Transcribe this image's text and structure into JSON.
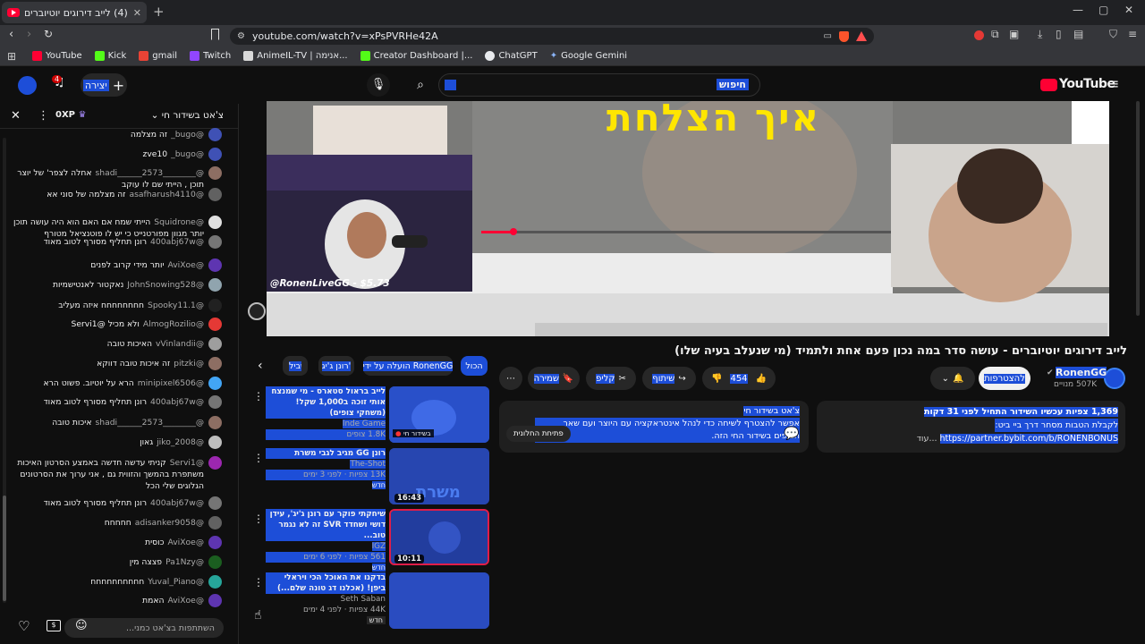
{
  "browser": {
    "tab_title": "(4) לייב דירוגים יוטיוברים - עושה",
    "url": "youtube.com/watch?v=xPsPVRHe42A",
    "bookmarks": [
      {
        "label": "YouTube",
        "color": "#ff0033"
      },
      {
        "label": "Kick",
        "color": "#53fc18"
      },
      {
        "label": "gmail",
        "color": "#ea4335"
      },
      {
        "label": "Twitch",
        "color": "#9146ff"
      },
      {
        "label": "AnimeIL-TV | אנימה...",
        "color": "#d9d9d9"
      },
      {
        "label": "Creator Dashboard |...",
        "color": "#53fc18"
      },
      {
        "label": "ChatGPT",
        "color": "#e8eaed"
      },
      {
        "label": "Google Gemini",
        "color": "#8ab4f8"
      }
    ]
  },
  "header": {
    "logo_text": "YouTube",
    "search_query": "חיפוש",
    "create_label": "יצירה",
    "notification_count": "4"
  },
  "chat": {
    "title": "צ'אט בשידור חי",
    "xp_label": "0XP",
    "input_placeholder": "השתתפות בצ'אט כמני...",
    "messages": [
      {
        "author": "@bugo_",
        "text": "זה מצלמה",
        "color": "#3f51b5"
      },
      {
        "author": "@bugo_",
        "text": "zve10",
        "color": "#3f51b5"
      },
      {
        "author": "@________shadi______2573",
        "text": "אחלה לצפר' של יוצר תוכן , הייתי שם לו עוקב",
        "color": "#8d6e63"
      },
      {
        "author": "@asafharush4110",
        "text": "זה מצלמה של סוני אא",
        "color": "#616161"
      },
      {
        "author": "@Squidrone",
        "text": "הייתי שמח אם האם הוא היה עושה תוכן יותר מגוון מפורטנייט כי יש לו פוטנציאל מטורף",
        "color": "#e0e0e0"
      },
      {
        "author": "@400abj67w",
        "text": "רונן תחליף מסורף לטוב מאוד",
        "color": "#757575"
      },
      {
        "author": "@AviXoe",
        "text": "יותר מידי קרוב לפנים",
        "color": "#5e35b1"
      },
      {
        "author": "@JohnSnowing528",
        "text": "נאקטור לאנטישמיות",
        "color": "#90a4ae"
      },
      {
        "author": "@Spooky11.1",
        "text": "חחחחחחחח איזה מעליב",
        "color": "#212121"
      },
      {
        "author": "@AlmogRozilio",
        "text": "ולא מכיל @Servi1",
        "color": "#e53935"
      },
      {
        "author": "@vVinlandii",
        "text": "האיכות טובה",
        "color": "#9e9e9e"
      },
      {
        "author": "@pitzki",
        "text": "זה איכות טובה דווקא",
        "color": "#8d6e63"
      },
      {
        "author": "@minipixel6506",
        "text": "הרא על יוטיוב. פשוט הרא",
        "color": "#42a5f5"
      },
      {
        "author": "@400abj67w",
        "text": "רונן תחליף מסורף לטוב מאוד",
        "color": "#757575"
      },
      {
        "author": "@________shadi______2573",
        "text": "איכות טובה",
        "color": "#8d6e63"
      },
      {
        "author": "@jiko_2008",
        "text": "גאון",
        "color": "#bdbdbd"
      },
      {
        "author": "@Servi1",
        "text": "קניתי עדשה חדשה באמצע הסרטון האיכות משתפרת בהמשך והזווית גם , אני ערוך את הסרטונים הגלוגים שלי הכל",
        "color": "#9c27b0"
      },
      {
        "author": "@400abj67w",
        "text": "רונן תחליף מסורף לטוב מאוד",
        "color": "#757575"
      },
      {
        "author": "@adisanker9058",
        "text": "חחחחח",
        "color": "#616161"
      },
      {
        "author": "@AviXoe",
        "text": "כוסית",
        "color": "#5e35b1"
      },
      {
        "author": "@Pa1Nzy",
        "text": "פצצה מין",
        "color": "#1b5e20"
      },
      {
        "author": "@Yuval_Piano",
        "text": "חחחחחחחחחח",
        "color": "#26a69a"
      },
      {
        "author": "@AviXoe",
        "text": "האמת",
        "color": "#5e35b1"
      }
    ]
  },
  "player": {
    "streamer_label": "@RonenLiveGG - $5.73",
    "overlay_title": "איך הצלחת"
  },
  "video": {
    "title": "לייב דירוגים יוטיוברים - עושה סדר במה נכון פעם אחת ולתמיד (מי שנעלב בעיה שלו)",
    "channel": "RonenGG",
    "subscribers": "507K מנויים",
    "subscribe_label": "להצטרפות",
    "likes": "454",
    "share_label": "שיתוף",
    "clip_label": "קליפ",
    "save_label": "שמירה",
    "views_line": "1,369 צפיות עכשיו  השידור התחיל לפני 31 דקות",
    "desc_line2": "לקבלת הטבות מסחר דרך ביי ביט:",
    "desc_link": "https://partner.bybit.com/b/RONENBONUS",
    "more_label": "...עוד",
    "live_chat_heading": "צ'אט בשידור חי",
    "live_chat_text": "אפשר להצטרף לשיחה כדי לנהל אינטראקציה עם היוצר ועם שאר הצופים בשידור החי הזה.",
    "open_panel_label": "פתיחת החלונית"
  },
  "chips": [
    {
      "label": "הכול",
      "selected": true
    },
    {
      "label": "הועלה על ידי RonenGG",
      "selected": false
    },
    {
      "label": "רונן ג'יג'",
      "selected": false
    },
    {
      "label": "בשביל",
      "selected": false
    }
  ],
  "recommendations": [
    {
      "title": "לייב בראול סטארס - מי שמנצח אותי זוכה ב1,000 שקל! (משחקי צופים)",
      "channel": "Inde Game",
      "meta": "1.8K צופים",
      "badge": "בשידור חי",
      "duration": ""
    },
    {
      "title": "רונן GG מגיב לגבי משרת",
      "channel": "The-Shot",
      "meta": "13K צפיות · לפני 3 ימים",
      "badge": "חדש",
      "duration": "16:43"
    },
    {
      "title": "שיחקתי פוקר עם רונן ג'יג', עידן דושי ושחדד SVR זה לא נגמר טוב...",
      "channel": "IGZ",
      "meta": "561 צפיות · לפני 6 ימים",
      "badge": "חדש",
      "duration": "10:11"
    },
    {
      "title": "בדקנו את האוכל הכי ויראלי ביפן! (אכלנו דג טונה שלם...)",
      "channel": "Seth Saban",
      "meta": "44K צפיות · לפני 4 ימים",
      "badge": "חדש",
      "duration": ""
    }
  ]
}
